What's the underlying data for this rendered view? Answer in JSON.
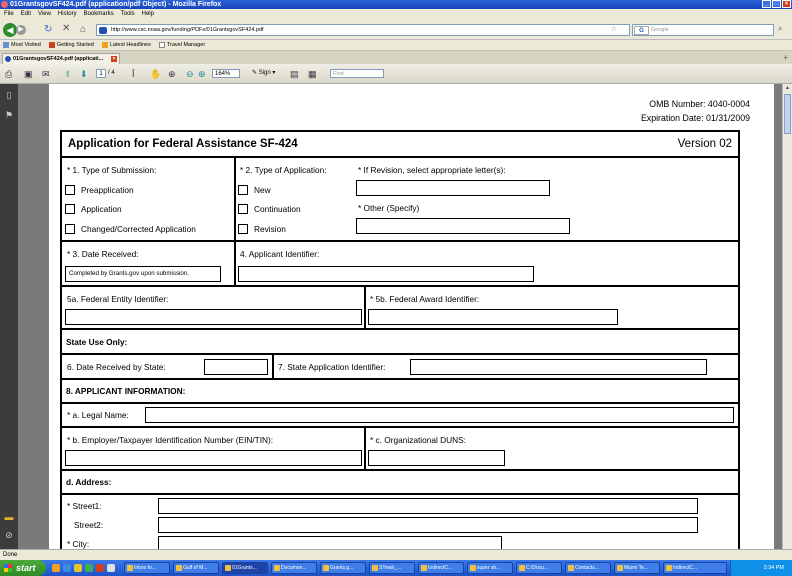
{
  "window": {
    "title": "01GrantsgovSF424.pdf (application/pdf Object) - Mozilla Firefox"
  },
  "menu": [
    "File",
    "Edit",
    "View",
    "History",
    "Bookmarks",
    "Tools",
    "Help"
  ],
  "nav": {
    "url": "http://www.csc.noaa.gov/funding/PDFs/01GrantsgovSF424.pdf",
    "search_placeholder": "Google",
    "search_engine_icon": "google-icon"
  },
  "bookmarks": [
    {
      "label": "Most Visited",
      "color": "#6a8fd8"
    },
    {
      "label": "Getting Started",
      "color": "#d04020"
    },
    {
      "label": "Latest Headlines",
      "color": "#f0a020"
    },
    {
      "label": "Travel Manager",
      "color": "#ffffff"
    }
  ],
  "tab": {
    "label": "01GrantsgovSF424.pdf (applicati..."
  },
  "pdf_toolbar": {
    "page_current": "1",
    "page_total": "/ 4",
    "zoom": "164%",
    "sign_label": "Sign",
    "find_placeholder": "Find"
  },
  "form": {
    "omb_number": "OMB Number: 4040-0004",
    "expiration": "Expiration Date: 01/31/2009",
    "title": "Application for Federal Assistance SF-424",
    "version": "Version 02",
    "type_of_submission_label": "* 1. Type of Submission:",
    "submission_options": [
      "Preapplication",
      "Application",
      "Changed/Corrected Application"
    ],
    "type_of_application_label": "* 2. Type of Application:",
    "application_options": [
      "New",
      "Continuation",
      "Revision"
    ],
    "revision_letters_label": "* If Revision, select appropriate letter(s):",
    "other_specify_label": "* Other (Specify)",
    "date_received_label": "* 3. Date Received:",
    "date_received_value": "Completed by Grants.gov upon submission.",
    "applicant_identifier_label": "4. Applicant Identifier:",
    "federal_entity_label": "5a. Federal Entity Identifier:",
    "federal_award_label": "* 5b. Federal Award Identifier:",
    "state_use_label": "State Use Only:",
    "date_received_state_label": "6. Date Received by State:",
    "state_app_id_label": "7. State Application Identifier:",
    "applicant_info_label": "8. APPLICANT INFORMATION:",
    "legal_name_label": "* a. Legal Name:",
    "ein_label": "* b. Employer/Taxpayer Identification Number (EIN/TIN):",
    "duns_label": "* c. Organizational DUNS:",
    "address_label": "d. Address:",
    "street1_label": "* Street1:",
    "street2_label": "Street2:",
    "city_label": "* City:"
  },
  "status": {
    "text": "Done"
  },
  "taskbar": {
    "start_label": "start",
    "items": [
      "Inbox fo...",
      "Gulf of M...",
      "01Grants...",
      "Documen...",
      "Grants.g...",
      "STwari_...",
      "IndirectC...",
      "super sh...",
      "C:\\Docu...",
      "Contacts...",
      "Miami Te...",
      "IndirectC..."
    ],
    "clock": "3:34 PM"
  }
}
